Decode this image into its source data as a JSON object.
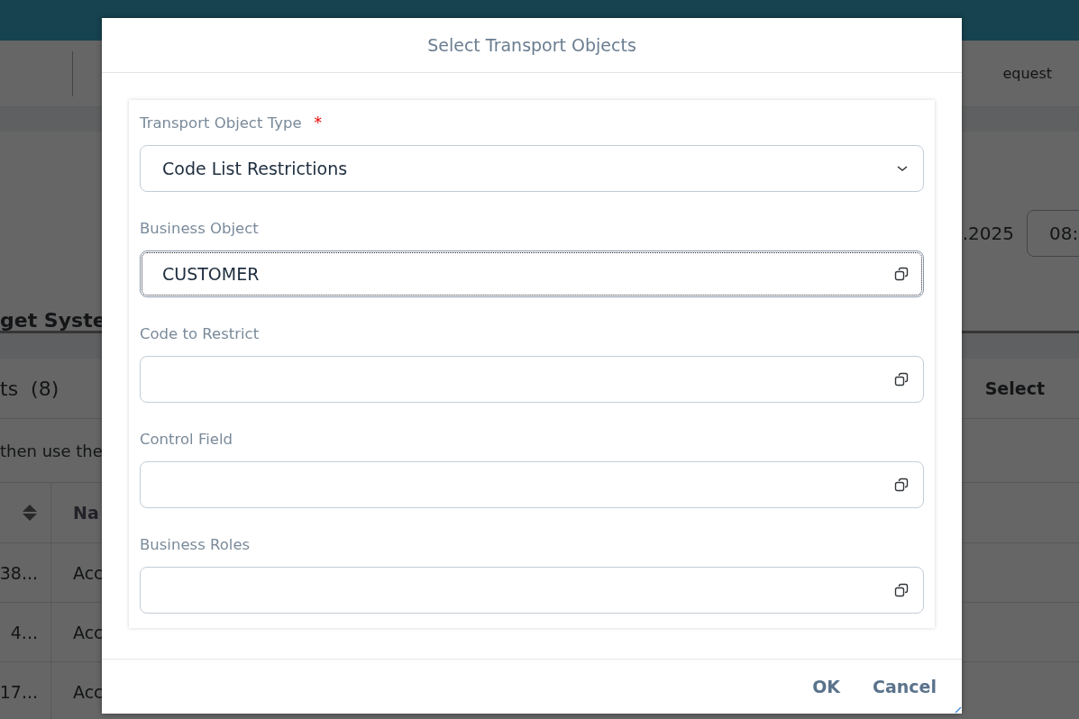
{
  "background": {
    "toolbar_text": "equest",
    "date": ".2025",
    "time": "08:",
    "section_title": "get Syste",
    "table_title": "ts",
    "table_count": "(8)",
    "select_action": "Select",
    "hint": "then use the",
    "column_header": "Na",
    "rows": [
      {
        "id": "38...",
        "name": "Acc"
      },
      {
        "id": "4...",
        "name": "Acc"
      },
      {
        "id": "17...",
        "name": "Acc"
      }
    ]
  },
  "dialog": {
    "title": "Select Transport Objects",
    "fields": [
      {
        "label": "Transport Object Type",
        "required_mark": "*",
        "kind": "select",
        "value": "Code List Restrictions",
        "focused": false
      },
      {
        "label": "Business Object",
        "kind": "value_help",
        "value": "CUSTOMER",
        "focused": true
      },
      {
        "label": "Code to Restrict",
        "kind": "value_help",
        "focused": false
      },
      {
        "label": "Control Field",
        "kind": "value_help",
        "focused": false
      },
      {
        "label": "Business Roles",
        "kind": "value_help",
        "focused": false
      }
    ],
    "buttons": [
      "OK",
      "Cancel"
    ]
  }
}
